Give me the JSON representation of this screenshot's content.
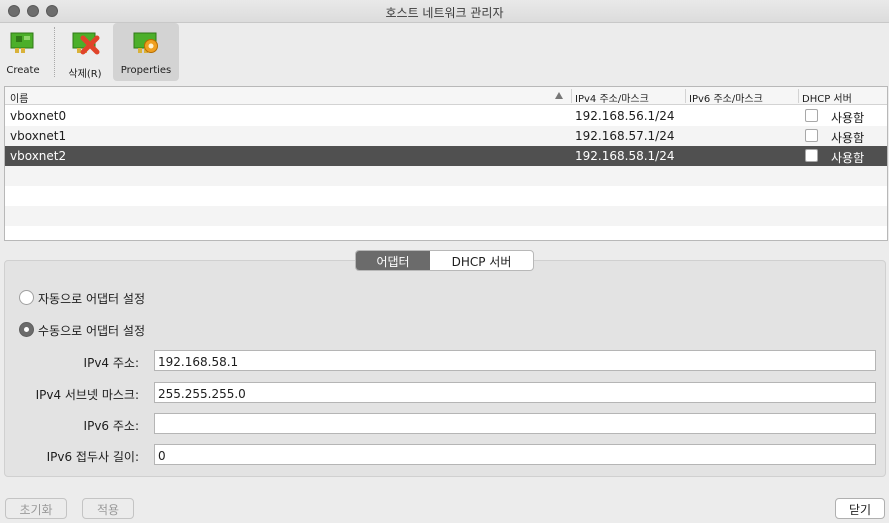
{
  "window": {
    "title": "호스트 네트워크 관리자"
  },
  "toolbar": {
    "create_label": "Create",
    "remove_label": "삭제(R)",
    "properties_label": "Properties",
    "nic_color": "#4caf2a",
    "remove_color": "#e0442a",
    "gear_color": "#f0a020"
  },
  "table": {
    "columns": [
      "이름",
      "IPv4 주소/마스크",
      "IPv6 주소/마스크",
      "DHCP 서버"
    ],
    "rows": [
      {
        "name": "vboxnet0",
        "ipv4": "192.168.56.1/24",
        "ipv6": "",
        "dhcp": "사용함",
        "dhcp_checked": false
      },
      {
        "name": "vboxnet1",
        "ipv4": "192.168.57.1/24",
        "ipv6": "",
        "dhcp": "사용함",
        "dhcp_checked": false
      },
      {
        "name": "vboxnet2",
        "ipv4": "192.168.58.1/24",
        "ipv6": "",
        "dhcp": "사용함",
        "dhcp_checked": false
      }
    ]
  },
  "tabs": {
    "adapter": "어댑터",
    "dhcp": "DHCP 서버"
  },
  "adapter": {
    "auto_label": "자동으로 어댑터 설정",
    "manual_label": "수동으로 어댑터 설정",
    "ipv4_addr_label": "IPv4 주소:",
    "ipv4_addr_value": "192.168.58.1",
    "ipv4_mask_label": "IPv4 서브넷 마스크:",
    "ipv4_mask_value": "255.255.255.0",
    "ipv6_addr_label": "IPv6 주소:",
    "ipv6_addr_value": "",
    "ipv6_prefix_label": "IPv6 접두사 길이:",
    "ipv6_prefix_value": "0"
  },
  "buttons": {
    "reset": "초기화",
    "apply": "적용",
    "close": "닫기"
  }
}
